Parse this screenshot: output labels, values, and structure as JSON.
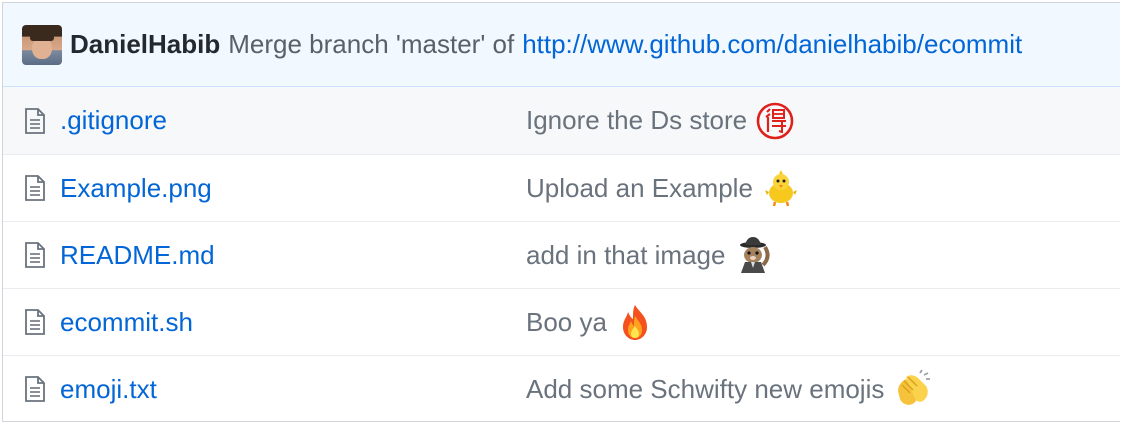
{
  "latest_commit": {
    "author": "DanielHabib",
    "message": "Merge branch 'master' of",
    "link_text": "http://www.github.com/danielhabib/ecommit"
  },
  "files": [
    {
      "name": ".gitignore",
      "commit_message": "Ignore the Ds store",
      "emoji": "red-circled-kanji-emoji"
    },
    {
      "name": "Example.png",
      "commit_message": "Upload an Example",
      "emoji": "hatching-chick-emoji"
    },
    {
      "name": "README.md",
      "commit_message": "add in that image",
      "emoji": "squirrel-spy-emoji"
    },
    {
      "name": "ecommit.sh",
      "commit_message": "Boo ya",
      "emoji": "fire-emoji"
    },
    {
      "name": "emoji.txt",
      "commit_message": "Add some Schwifty new emojis",
      "emoji": "clapping-hands-emoji"
    }
  ],
  "colors": {
    "link": "#0366d6",
    "commit_bar_bg": "#f1f8ff",
    "muted_text": "#6a737d"
  }
}
